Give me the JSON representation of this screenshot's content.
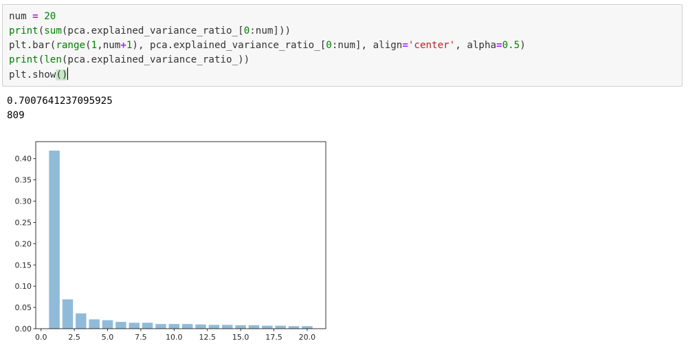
{
  "code_cell": {
    "lines": [
      [
        {
          "t": "num ",
          "c": "kw-var"
        },
        {
          "t": "=",
          "c": "kw-op"
        },
        {
          "t": " ",
          "c": "kw-var"
        },
        {
          "t": "20",
          "c": "kw-num"
        }
      ],
      [
        {
          "t": "print",
          "c": "kw-builtin"
        },
        {
          "t": "(",
          "c": "kw-var"
        },
        {
          "t": "sum",
          "c": "kw-builtin"
        },
        {
          "t": "(pca.explained_variance_ratio_[",
          "c": "kw-var"
        },
        {
          "t": "0",
          "c": "kw-num"
        },
        {
          "t": ":num]))",
          "c": "kw-var"
        }
      ],
      [
        {
          "t": "plt.bar(",
          "c": "kw-var"
        },
        {
          "t": "range",
          "c": "kw-builtin"
        },
        {
          "t": "(",
          "c": "kw-var"
        },
        {
          "t": "1",
          "c": "kw-num"
        },
        {
          "t": ",num",
          "c": "kw-var"
        },
        {
          "t": "+",
          "c": "kw-op"
        },
        {
          "t": "1",
          "c": "kw-num"
        },
        {
          "t": "), pca.explained_variance_ratio_[",
          "c": "kw-var"
        },
        {
          "t": "0",
          "c": "kw-num"
        },
        {
          "t": ":num], align",
          "c": "kw-var"
        },
        {
          "t": "=",
          "c": "kw-op"
        },
        {
          "t": "'center'",
          "c": "kw-str"
        },
        {
          "t": ", alpha",
          "c": "kw-var"
        },
        {
          "t": "=",
          "c": "kw-op"
        },
        {
          "t": "0.5",
          "c": "kw-num"
        },
        {
          "t": ")",
          "c": "kw-var"
        }
      ],
      [
        {
          "t": "print",
          "c": "kw-builtin"
        },
        {
          "t": "(",
          "c": "kw-var"
        },
        {
          "t": "len",
          "c": "kw-builtin"
        },
        {
          "t": "(pca.explained_variance_ratio_))",
          "c": "kw-var"
        }
      ],
      [
        {
          "t": "plt.show",
          "c": "kw-var"
        },
        {
          "t": "()",
          "c": "paren-hl"
        }
      ]
    ]
  },
  "output": {
    "lines": [
      "0.7007641237095925",
      "809"
    ]
  },
  "colors": {
    "bar": "#1f77b4",
    "bar_alpha": 0.5,
    "axis": "#000000"
  },
  "chart_data": {
    "type": "bar",
    "x": [
      1,
      2,
      3,
      4,
      5,
      6,
      7,
      8,
      9,
      10,
      11,
      12,
      13,
      14,
      15,
      16,
      17,
      18,
      19,
      20
    ],
    "values": [
      0.419,
      0.069,
      0.036,
      0.022,
      0.02,
      0.016,
      0.014,
      0.014,
      0.011,
      0.011,
      0.011,
      0.01,
      0.009,
      0.009,
      0.008,
      0.008,
      0.007,
      0.007,
      0.006,
      0.006
    ],
    "xlim": [
      -0.4,
      21.4
    ],
    "ylim": [
      0,
      0.44
    ],
    "xticks": [
      0.0,
      2.5,
      5.0,
      7.5,
      10.0,
      12.5,
      15.0,
      17.5,
      20.0
    ],
    "xtick_labels": [
      "0.0",
      "2.5",
      "5.0",
      "7.5",
      "10.0",
      "12.5",
      "15.0",
      "17.5",
      "20.0"
    ],
    "yticks": [
      0.0,
      0.05,
      0.1,
      0.15,
      0.2,
      0.25,
      0.3,
      0.35,
      0.4
    ],
    "ytick_labels": [
      "0.00",
      "0.05",
      "0.10",
      "0.15",
      "0.20",
      "0.25",
      "0.30",
      "0.35",
      "0.40"
    ],
    "bar_width": 0.8,
    "grid": false,
    "title": "",
    "xlabel": "",
    "ylabel": ""
  }
}
